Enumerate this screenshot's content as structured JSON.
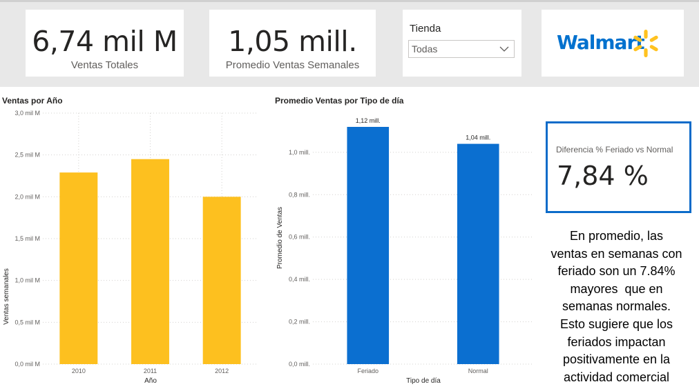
{
  "kpis": {
    "total_sales": {
      "value": "6,74 mil M",
      "label": "Ventas Totales"
    },
    "avg_weekly_sales": {
      "value": "1,05 mill.",
      "label": "Promedio Ventas Semanales"
    }
  },
  "slicer": {
    "title": "Tienda",
    "value": "Todas"
  },
  "logo": {
    "text": "Walmart",
    "brand_color": "#0071ce",
    "spark_color": "#ffc220"
  },
  "diff_card": {
    "title": "Diferencia % Feriado vs Normal",
    "value": "7,84 %",
    "border_color": "#0b6bc9"
  },
  "note": {
    "lines": [
      "En promedio, las",
      "ventas en semanas con",
      "feriado son un 7.84%",
      "mayores  que en",
      "semanas normales.",
      "Esto sugiere que los",
      "feriados impactan",
      "positivamente en la",
      "actividad comercial"
    ]
  },
  "chart_data": [
    {
      "type": "bar",
      "title": "Ventas por Año",
      "xlabel": "Año",
      "ylabel": "Ventas semanales",
      "categories": [
        "2010",
        "2011",
        "2012"
      ],
      "values": [
        2.29,
        2.45,
        2.0
      ],
      "ylim": [
        0,
        3.0
      ],
      "yticks": [
        0,
        0.5,
        1.0,
        1.5,
        2.0,
        2.5,
        3.0
      ],
      "ytick_labels": [
        "0,0 mil M",
        "0,5 mil M",
        "1,0 mil M",
        "1,5 mil M",
        "2,0 mil M",
        "2,5 mil M",
        "3,0 mil M"
      ],
      "color": "#fdc01f",
      "grid": true
    },
    {
      "type": "bar",
      "title": "Promedio Ventas por Tipo de día",
      "xlabel": "Tipo de día",
      "ylabel": "Promedio de Ventas",
      "categories": [
        "Feriado",
        "Normal"
      ],
      "values": [
        1.12,
        1.04
      ],
      "data_labels": [
        "1,12 mill.",
        "1,04 mill."
      ],
      "ylim": [
        0,
        1.12
      ],
      "yticks": [
        0,
        0.2,
        0.4,
        0.6,
        0.8,
        1.0
      ],
      "ytick_labels": [
        "0,0 mill.",
        "0,2 mill.",
        "0,4 mill.",
        "0,6 mill.",
        "0,8 mill.",
        "1,0 mill."
      ],
      "color": "#0b6fd0",
      "grid": true
    }
  ]
}
